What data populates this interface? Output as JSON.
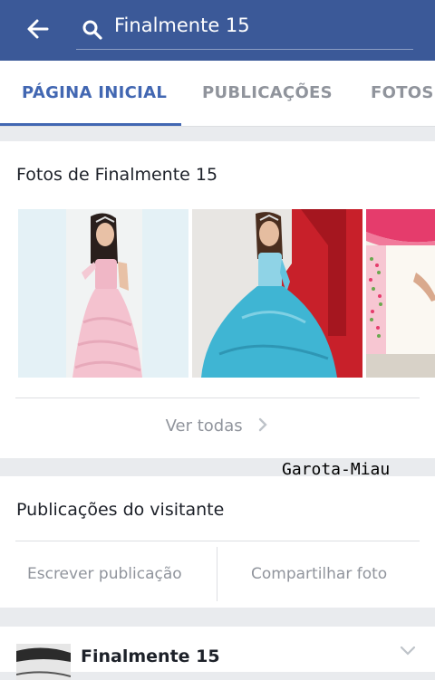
{
  "header": {
    "search_value": "Finalmente 15",
    "back_icon": "back-arrow-icon",
    "search_icon": "search-icon"
  },
  "tabs": [
    {
      "label": "PÁGINA INICIAL",
      "active": true
    },
    {
      "label": "PUBLICAÇÕES",
      "active": false
    },
    {
      "label": "FOTOS",
      "active": false
    }
  ],
  "photos_section": {
    "title": "Fotos de Finalmente 15",
    "see_all": "Ver todas",
    "photos": [
      "pink-dress-photo",
      "blue-dress-photo",
      "decor-photo"
    ]
  },
  "watermark": "Garota-Miau",
  "visitor_section": {
    "title": "Publicações do visitante",
    "write_post": "Escrever publicação",
    "share_photo": "Compartilhar foto"
  },
  "post": {
    "author": "Finalmente 15"
  },
  "colors": {
    "brand": "#3b5998",
    "accent": "#4267b2",
    "muted": "#90949c"
  }
}
